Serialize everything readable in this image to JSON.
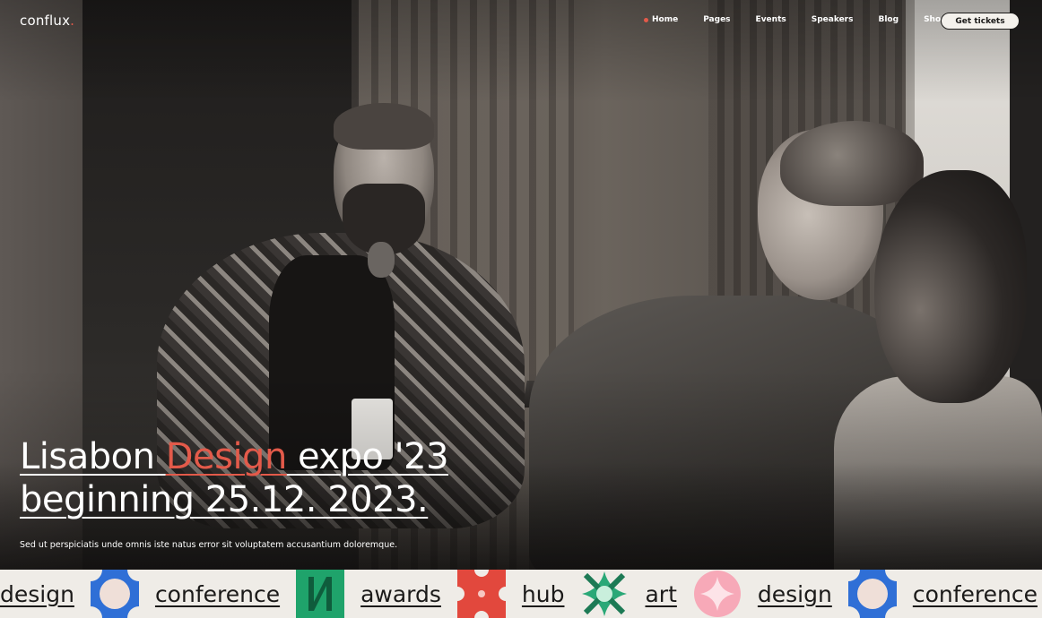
{
  "brand": {
    "name": "conflux",
    "dot": ".",
    "accent": "#e35a4a"
  },
  "nav": {
    "items": [
      {
        "label": "Home",
        "active": true
      },
      {
        "label": "Pages"
      },
      {
        "label": "Events"
      },
      {
        "label": "Speakers"
      },
      {
        "label": "Blog"
      },
      {
        "label": "Shop"
      }
    ],
    "cta": "Get tickets"
  },
  "hero": {
    "line1_pre": "Lisabon ",
    "line1_accent": "Design",
    "line1_post": " expo '23",
    "line2": "beginning 25.12. 2023.",
    "subtext": "Sed ut perspiciatis unde omnis iste natus error sit voluptatem accusantium doloremque."
  },
  "strip": {
    "words": [
      "design",
      "conference",
      "awards",
      "hub",
      "art",
      "design",
      "conference"
    ],
    "shapes": [
      {
        "icon": "blue-flower-icon",
        "color": "#2f6fd6"
      },
      {
        "icon": "green-n-icon",
        "color": "#1fa36b"
      },
      {
        "icon": "red-cross-icon",
        "color": "#e2483d"
      },
      {
        "icon": "green-star-icon",
        "color": "#2aa877"
      },
      {
        "icon": "pink-sparkle-icon",
        "color": "#f7a9b8"
      },
      {
        "icon": "blue-flower-icon",
        "color": "#2f6fd6"
      }
    ]
  }
}
